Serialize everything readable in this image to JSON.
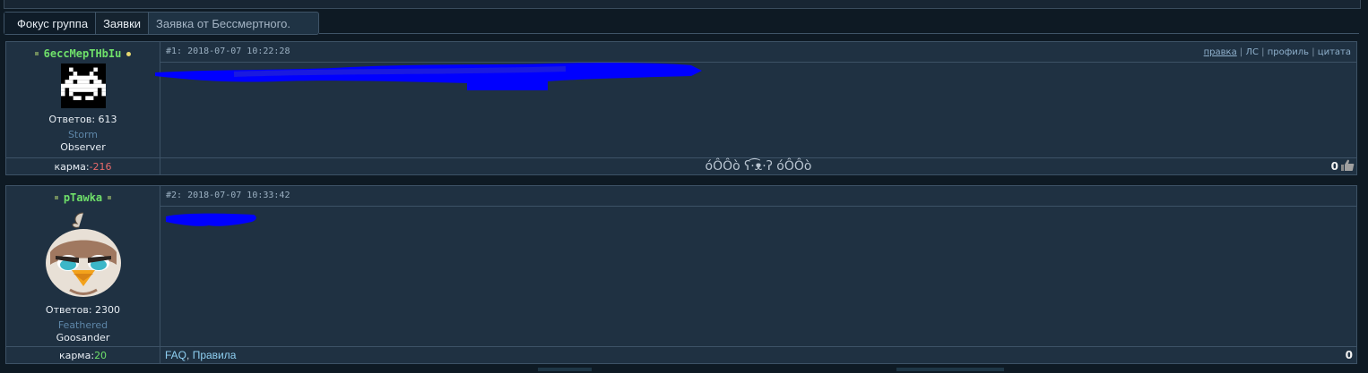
{
  "breadcrumb": {
    "items": [
      "Фокус группа",
      "Заявки"
    ],
    "current": "Заявка от Бессмертного."
  },
  "posts": [
    {
      "username": "6еccMepTHbIu",
      "online_dot": "yellow",
      "replies_label": "Ответов: 613",
      "rank": "Storm",
      "title": "Observer",
      "karma_label": "карма: ",
      "karma_value": "-216",
      "number_date": "#1: 2018-07-07 10:22:28",
      "actions": [
        "правка",
        "ЛС",
        "профиль",
        "цитата"
      ],
      "signature": "óÔÔò ʕ·͡ᴥ·ʔ óÔÔò",
      "rating": "0",
      "avatar_icon": "space-invader-icon",
      "thumb_icon": "thumbs-up-icon"
    },
    {
      "username": "pTawka",
      "online_dot": "grey",
      "replies_label": "Ответов: 2300",
      "rank": "Feathered",
      "title": "Goosander",
      "karma_label": "карма: ",
      "karma_value": "20",
      "number_date": "#2: 2018-07-07 10:33:42",
      "footer_links": [
        "FAQ",
        "Правила"
      ],
      "rating": "0",
      "avatar_icon": "angry-bird-avatar-icon"
    }
  ],
  "colors": {
    "background": "#0e1a24",
    "panel": "#1f3142",
    "username": "#6fe06a",
    "karma_negative": "#e86a6a",
    "link": "#8fd0f2",
    "scribble": "#0000ff"
  }
}
